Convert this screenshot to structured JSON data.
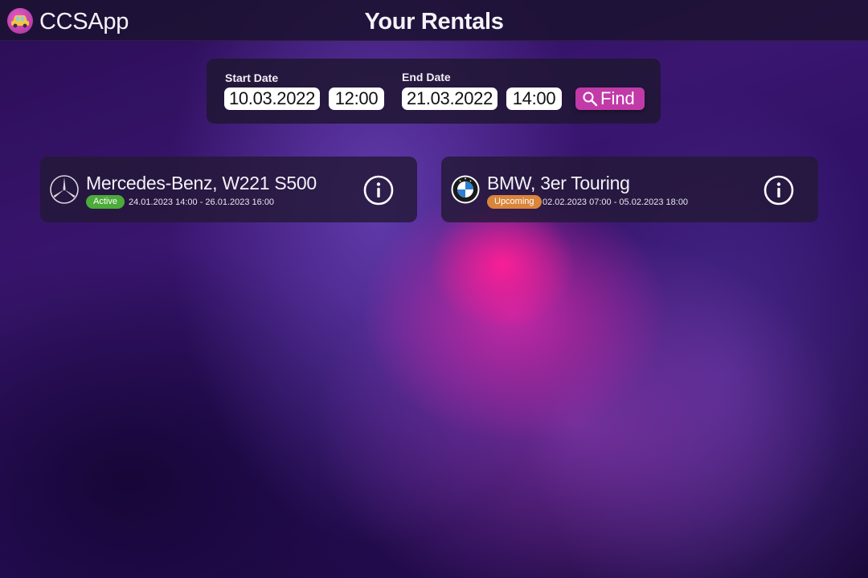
{
  "app": {
    "name": "CCSApp",
    "logo_icon": "car-logo-icon"
  },
  "page": {
    "title": "Your Rentals"
  },
  "filter": {
    "start_label": "Start Date",
    "start_date": "10.03.2022",
    "start_time": "12:00",
    "end_label": "End Date",
    "end_date": "21.03.2022",
    "end_time": "14:00",
    "find_label": "Find",
    "find_icon": "search-icon"
  },
  "rentals": [
    {
      "car": "Mercedes-Benz, W221 S500",
      "brand_icon": "mercedes-logo-icon",
      "status": "Active",
      "period": "24.01.2023 14:00 - 26.01.2023 16:00",
      "info_icon": "info-icon"
    },
    {
      "car": "BMW, 3er Touring",
      "brand_icon": "bmw-logo-icon",
      "status": "Upcoming",
      "period": "02.02.2023 07:00 - 05.02.2023 18:00",
      "info_icon": "info-icon"
    }
  ],
  "colors": {
    "accent": "#c13aa8",
    "status_active": "#4cab3a",
    "status_upcoming": "#d9853a",
    "panel": "#20163a"
  }
}
